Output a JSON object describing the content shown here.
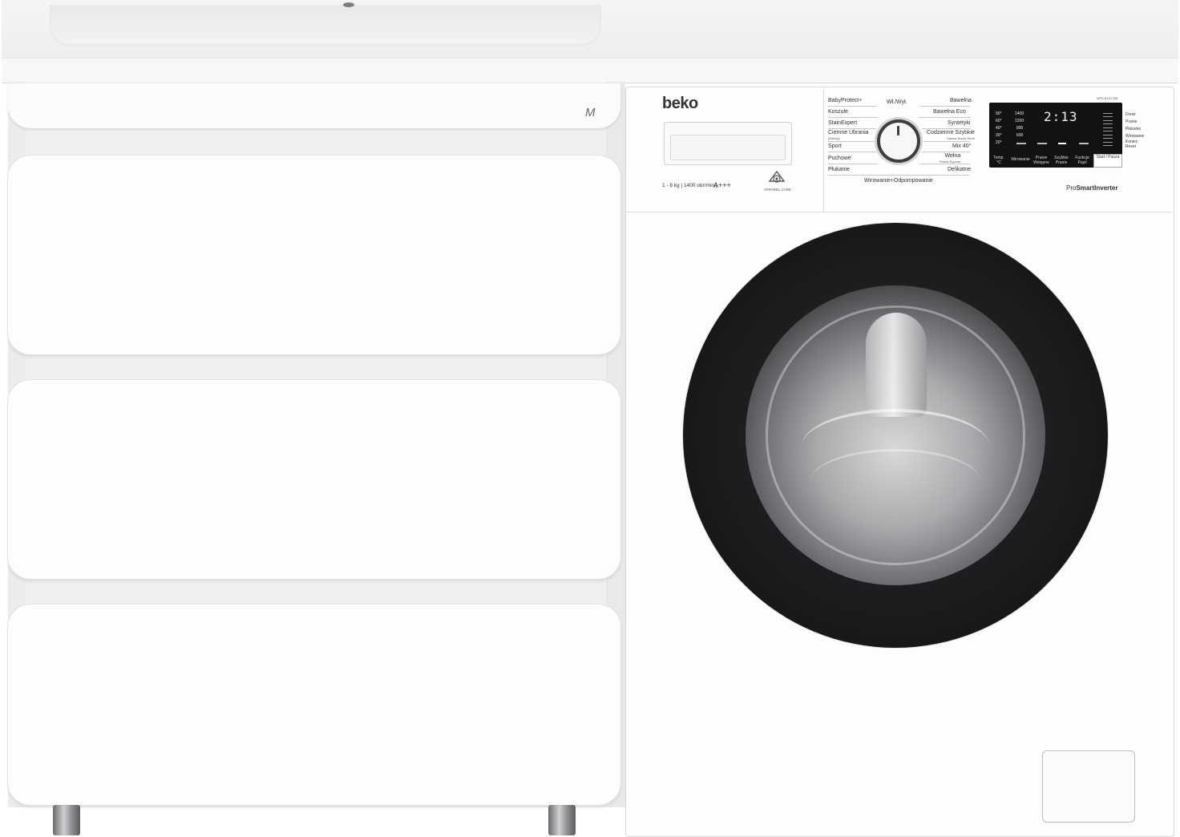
{
  "cabinet": {
    "logo": "M"
  },
  "washer": {
    "brand": "beko",
    "capacity": "1 - 8 kg",
    "max_spin": "1400 obr/min",
    "energy_class": "A+++",
    "care_label": "APPAREL CARE",
    "power_label": "Wł./Wył.",
    "bottom_label": "Wirowanie+Odpompowanie",
    "programs_left": [
      {
        "label": "BabyProtect+",
        "sub": ""
      },
      {
        "label": "Koszule",
        "sub": ""
      },
      {
        "label": "StainExpert",
        "sub": ""
      },
      {
        "label": "Ciemne Ubrania",
        "sub": "(Dżinsy)"
      },
      {
        "label": "Sport",
        "sub": ""
      },
      {
        "label": "Puchowe",
        "sub": ""
      },
      {
        "label": "Płukanie",
        "sub": ""
      }
    ],
    "programs_right": [
      {
        "label": "Bawełna",
        "sub": ""
      },
      {
        "label": "Bawełna Eco",
        "sub": ""
      },
      {
        "label": "Syntetyki",
        "sub": ""
      },
      {
        "label": "Codzienne Szybkie",
        "sub": "Xpress Super Short"
      },
      {
        "label": "Mix 40°",
        "sub": ""
      },
      {
        "label": "Wełna",
        "sub": "Pranie Ręczne"
      },
      {
        "label": "Delikatne",
        "sub": ""
      }
    ],
    "model": "WTV 8712 XW",
    "display": {
      "time": "2:13",
      "temps": [
        "90°",
        "60°",
        "40°",
        "30°",
        "20°"
      ],
      "speeds": [
        "1400",
        "1200",
        "800",
        "600"
      ]
    },
    "buttons": [
      {
        "label": "Temp. °C"
      },
      {
        "label": "Wirowanie"
      },
      {
        "label": "Pranie Wstępne"
      },
      {
        "label": "Szybkie Pranie"
      },
      {
        "label": "Funkcje Pupil"
      }
    ],
    "start_button": "Start / Pauza",
    "status": [
      "Drzwi",
      "Pranie",
      "Płukanie",
      "Wirowanie",
      "Koniec",
      "Reset"
    ],
    "badge_prefix": "Pro",
    "badge_mid": "Smart",
    "badge_suffix": "Inverter"
  }
}
